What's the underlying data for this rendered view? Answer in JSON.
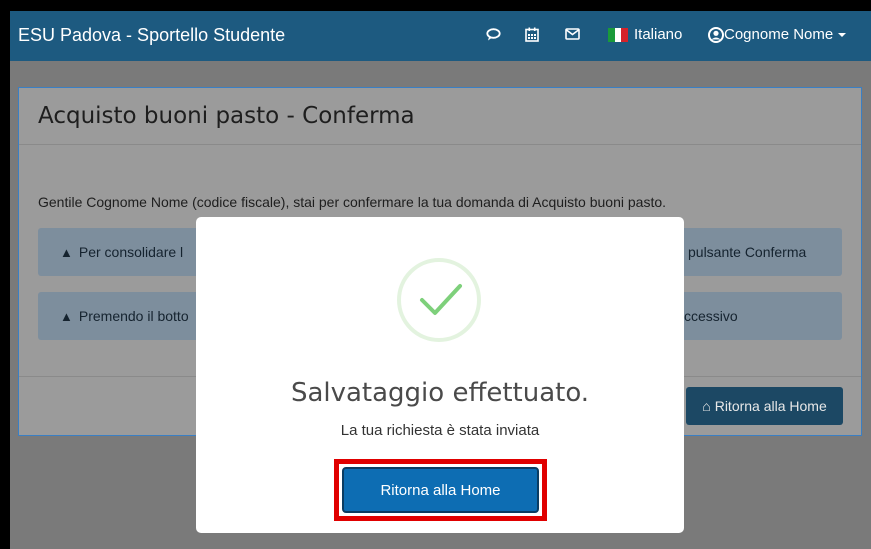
{
  "navbar": {
    "brand": "ESU Padova - Sportello Studente",
    "icons": [
      "chat-icon",
      "calendar-icon",
      "mail-icon"
    ],
    "language": "Italiano",
    "user": "Cognome Nome",
    "color": "#1d5a80"
  },
  "panel": {
    "title": "Acquisto buoni pasto - Conferma",
    "intro": "Gentile Cognome Nome (codice fiscale), stai per confermare la tua domanda di Acquisto buoni pasto.",
    "alerts": [
      {
        "left": "Per consolidare l",
        "right": "pulsante Conferma"
      },
      {
        "left": "Premendo il botto",
        "right": "ccessivo"
      }
    ],
    "home_button": "Ritorna alla Home"
  },
  "modal": {
    "title": "Salvataggio effettuato.",
    "message": "La tua richiesta è stata inviata",
    "button": "Ritorna alla Home",
    "button_color": "#0d6db3",
    "highlight_color": "#e00000",
    "check_color": "#7ed07b"
  }
}
